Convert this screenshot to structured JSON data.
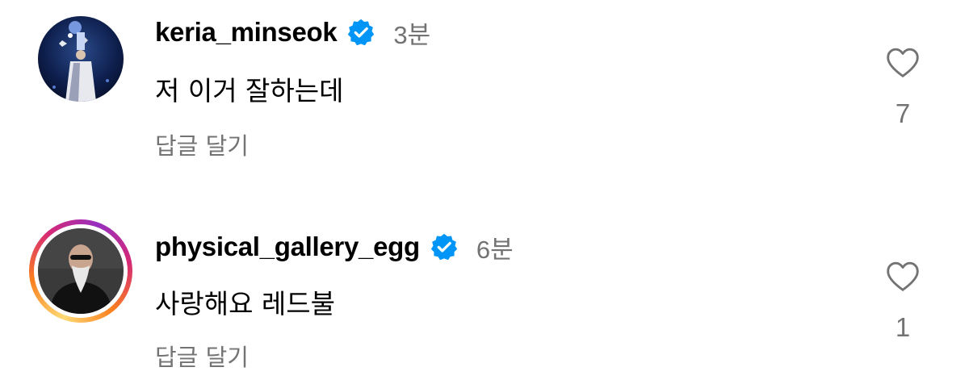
{
  "colors": {
    "username": "#000000",
    "secondary_text": "#737373",
    "verified_badge": "#0095f6",
    "story_ring": [
      "#feda75",
      "#fa7e1e",
      "#d62976",
      "#962fbf"
    ]
  },
  "comments": [
    {
      "username": "keria_minseok",
      "verified": true,
      "verified_icon": "verified-badge-icon",
      "timestamp": "3분",
      "text": "저 이거 잘하는데",
      "reply_label": "답글 달기",
      "like_icon": "heart-outline-icon",
      "like_count": "7",
      "has_story_ring": false
    },
    {
      "username": "physical_gallery_egg",
      "verified": true,
      "verified_icon": "verified-badge-icon",
      "timestamp": "6분",
      "text": "사랑해요 레드불",
      "reply_label": "답글 달기",
      "like_icon": "heart-outline-icon",
      "like_count": "1",
      "has_story_ring": true
    }
  ]
}
